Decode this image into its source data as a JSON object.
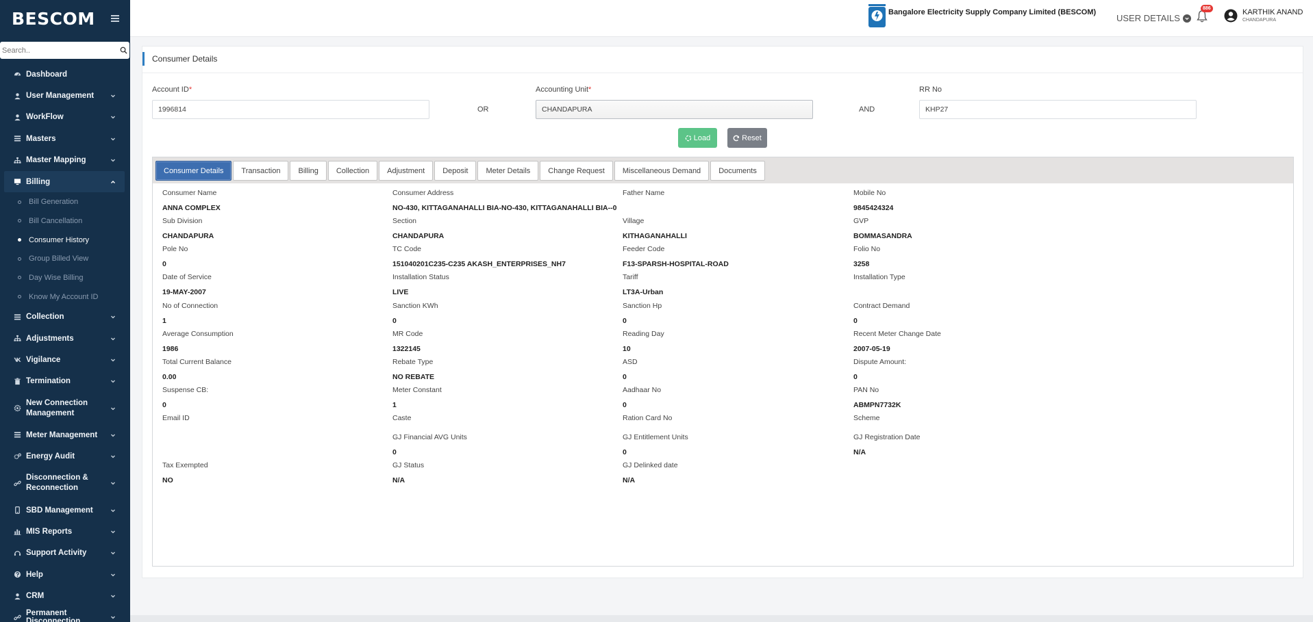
{
  "sidebar": {
    "brand": "BESCOM",
    "search_placeholder": "Search..",
    "items_top": [
      {
        "label": "Dashboard",
        "icon": "dashboard-icon",
        "chevron": false
      },
      {
        "label": "User Management",
        "icon": "user-icon",
        "chevron": true
      },
      {
        "label": "WorkFlow",
        "icon": "user-icon",
        "chevron": true
      },
      {
        "label": "Masters",
        "icon": "list-icon",
        "chevron": true
      },
      {
        "label": "Master Mapping",
        "icon": "sitemap-icon",
        "chevron": true
      }
    ],
    "active_item": {
      "label": "Billing",
      "icon": "monitor-icon"
    },
    "sub_items": [
      {
        "label": "Bill Generation",
        "current": false
      },
      {
        "label": "Bill Cancellation",
        "current": false
      },
      {
        "label": "Consumer History",
        "current": true
      },
      {
        "label": "Group Billed View",
        "current": false
      },
      {
        "label": "Day Wise Billing",
        "current": false
      },
      {
        "label": "Know My Account ID",
        "current": false
      }
    ],
    "items_bottom": [
      {
        "label": "Collection",
        "icon": "list-icon",
        "two_line": false
      },
      {
        "label": "Adjustments",
        "icon": "sitemap-icon",
        "two_line": false
      },
      {
        "label": "Vigilance",
        "icon": "vk-icon",
        "two_line": false
      },
      {
        "label": "Termination",
        "icon": "trash-icon",
        "two_line": false
      },
      {
        "label": "New Connection Management",
        "icon": "gear-icon",
        "two_line": true
      },
      {
        "label": "Meter Management",
        "icon": "list-icon",
        "two_line": false
      },
      {
        "label": "Energy Audit",
        "icon": "gears-icon",
        "two_line": false
      },
      {
        "label": "Disconnection & Reconnection",
        "icon": "link-icon",
        "two_line": true
      },
      {
        "label": "SBD Management",
        "icon": "mobile-icon",
        "two_line": false
      },
      {
        "label": "MIS Reports",
        "icon": "bar-chart-icon",
        "two_line": false
      },
      {
        "label": "Support Activity",
        "icon": "headset-icon",
        "two_line": false
      },
      {
        "label": "Help",
        "icon": "help-icon",
        "two_line": false
      },
      {
        "label": "CRM",
        "icon": "user-icon",
        "two_line": false
      },
      {
        "label": "Permanent Disconnection",
        "icon": "link-icon",
        "two_line": false
      }
    ]
  },
  "header": {
    "company_name": "Bangalore Electricity Supply Company Limited (BESCOM)",
    "user_details_label": "USER DETAILS",
    "notification_count": "886",
    "user_name": "KARTHIK ANAND",
    "user_location": "CHANDAPURA"
  },
  "form": {
    "title": "Consumer Details",
    "account_id_label": "Account ID",
    "account_id_value": "1996814",
    "or_label": "OR",
    "accounting_unit_label": "Accounting Unit",
    "accounting_unit_value": "CHANDAPURA",
    "and_label": "AND",
    "rr_no_label": "RR No",
    "rr_no_value": "KHP27",
    "load_label": "Load",
    "reset_label": "Reset"
  },
  "tabs": [
    {
      "label": "Consumer Details",
      "active": true
    },
    {
      "label": "Transaction",
      "active": false
    },
    {
      "label": "Billing",
      "active": false
    },
    {
      "label": "Collection",
      "active": false
    },
    {
      "label": "Adjustment",
      "active": false
    },
    {
      "label": "Deposit",
      "active": false
    },
    {
      "label": "Meter Details",
      "active": false
    },
    {
      "label": "Change Request",
      "active": false
    },
    {
      "label": "Miscellaneous Demand",
      "active": false
    },
    {
      "label": "Documents",
      "active": false
    }
  ],
  "consumer_rows": [
    [
      {
        "label": "Consumer Name",
        "value": "ANNA COMPLEX"
      },
      {
        "label": "Consumer Address",
        "value": "NO-430, KITTAGANAHALLI BIA-NO-430, KITTAGANAHALLI BIA--0"
      },
      {
        "label": "Father Name",
        "value": ""
      },
      {
        "label": "Mobile No",
        "value": "9845424324"
      }
    ],
    [
      {
        "label": "Sub Division",
        "value": "CHANDAPURA"
      },
      {
        "label": "Section",
        "value": "CHANDAPURA"
      },
      {
        "label": "Village",
        "value": "KITHAGANAHALLI"
      },
      {
        "label": "GVP",
        "value": "BOMMASANDRA"
      }
    ],
    [
      {
        "label": "Pole No",
        "value": "0"
      },
      {
        "label": "TC Code",
        "value": "151040201C235-C235 AKASH_ENTERPRISES_NH7"
      },
      {
        "label": "Feeder Code",
        "value": "F13-SPARSH-HOSPITAL-ROAD"
      },
      {
        "label": "Folio No",
        "value": "3258"
      }
    ],
    [
      {
        "label": "Date of Service",
        "value": "19-MAY-2007"
      },
      {
        "label": "Installation Status",
        "value": "LIVE"
      },
      {
        "label": "Tariff",
        "value": "LT3A-Urban"
      },
      {
        "label": "Installation Type",
        "value": ""
      }
    ],
    [
      {
        "label": "No of Connection",
        "value": "1"
      },
      {
        "label": "Sanction KWh",
        "value": "0"
      },
      {
        "label": "Sanction Hp",
        "value": "0"
      },
      {
        "label": "Contract Demand",
        "value": "0"
      }
    ],
    [
      {
        "label": "Average Consumption",
        "value": "1986"
      },
      {
        "label": "MR Code",
        "value": "1322145"
      },
      {
        "label": "Reading Day",
        "value": "10"
      },
      {
        "label": "Recent Meter Change Date",
        "value": "2007-05-19"
      }
    ],
    [
      {
        "label": "Total Current Balance",
        "value": "0.00"
      },
      {
        "label": "Rebate Type",
        "value": "NO REBATE"
      },
      {
        "label": "ASD",
        "value": "0"
      },
      {
        "label": "Dispute Amount:",
        "value": "0"
      }
    ],
    [
      {
        "label": "Suspense CB:",
        "value": "0"
      },
      {
        "label": "Meter Constant",
        "value": "1"
      },
      {
        "label": "Aadhaar No",
        "value": "0"
      },
      {
        "label": "PAN No",
        "value": "ABMPN7732K"
      }
    ],
    [
      {
        "label": "Email ID",
        "value": ""
      },
      {
        "label": "Caste",
        "value": ""
      },
      {
        "label": "Ration Card No",
        "value": ""
      },
      {
        "label": "Scheme",
        "value": ""
      }
    ],
    [
      null,
      {
        "label": "GJ Financial AVG Units",
        "value": "0"
      },
      {
        "label": "GJ Entitlement Units",
        "value": "0"
      },
      {
        "label": "GJ Registration Date",
        "value": "N/A"
      }
    ],
    [
      {
        "label": "Tax Exempted",
        "value": "NO"
      },
      {
        "label": "GJ Status",
        "value": "N/A"
      },
      {
        "label": "GJ Delinked date",
        "value": "N/A"
      },
      null
    ]
  ]
}
